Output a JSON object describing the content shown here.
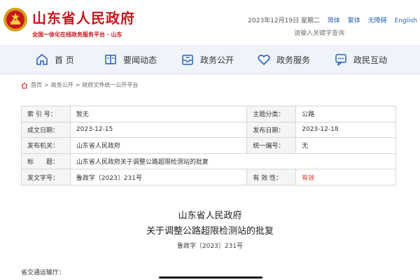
{
  "header": {
    "site_title": "山东省人民政府",
    "site_subtitle": "全国一体化在线政务服务平台 · 山东",
    "date": "2023年12月19日 星期二",
    "links": [
      "简体",
      "繁体",
      "无障碍",
      "English"
    ],
    "search_placeholder": "请输入关键字查询"
  },
  "nav": {
    "items": [
      {
        "label": "首 页",
        "icon": "home-icon"
      },
      {
        "label": "要闻动态",
        "icon": "book-icon"
      },
      {
        "label": "政务公开",
        "icon": "inbox-icon"
      },
      {
        "label": "政务服务",
        "icon": "heart-icon"
      },
      {
        "label": "政民互动",
        "icon": "chat-icon"
      }
    ]
  },
  "breadcrumb": {
    "items": [
      "首页",
      ">",
      "政务公开",
      ">",
      "政府文件统一公开平台"
    ]
  },
  "meta": {
    "index_label": "索 引 号：",
    "index_value": "暂无",
    "topic_label": "主题分类：",
    "topic_value": "公路",
    "created_label": "成文日期：",
    "created_value": "2023-12-15",
    "published_label": "发布日期：",
    "published_value": "2023-12-18",
    "issuer_label": "发布机关：",
    "issuer_value": "山东省人民政府",
    "serial_label": "统一编号：",
    "serial_value": "无",
    "title_label": "标　　题：",
    "title_value": "山东省人民政府关于调整公路超限检测站的批复",
    "docno_label": "发文字号：",
    "docno_value": "鲁政字〔2023〕231号",
    "validity_label": "有 效 性：",
    "validity_value": "有效",
    "validity_color": "#d9332b"
  },
  "document": {
    "issuer": "山东省人民政府",
    "title": "关于调整公路超限检测站的批复",
    "number": "鲁政字〔2023〕231号",
    "recipient": "省交通运输厅："
  },
  "colors": {
    "brand_red": "#c8161d",
    "link_blue": "#2b63b8",
    "nav_bg": "#f0f4fa"
  }
}
